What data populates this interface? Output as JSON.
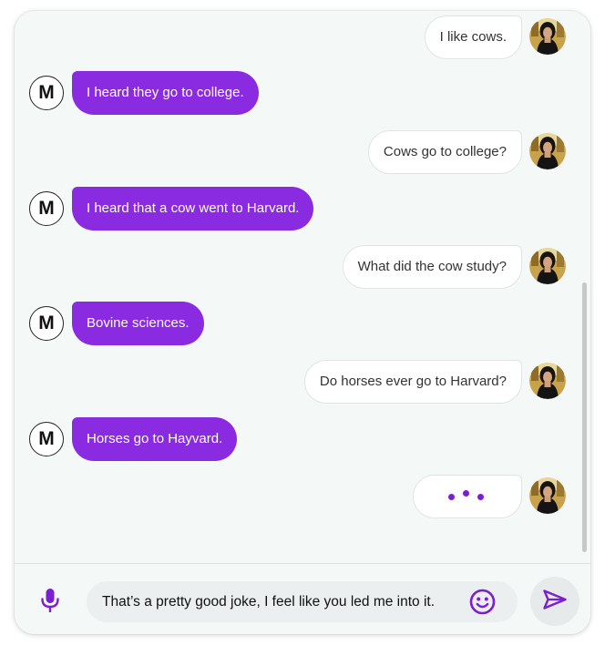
{
  "colors": {
    "accent": "#8a2be2",
    "page_background": "#f4f8f6",
    "user_bubble": "#ffffff",
    "icon_accent": "#7b1fcf"
  },
  "bot": {
    "avatar_letter": "M"
  },
  "user": {
    "avatar_icon": "user-photo-avatar"
  },
  "messages": [
    {
      "sender": "user",
      "text": "I like cows."
    },
    {
      "sender": "bot",
      "text": "I heard they go to college."
    },
    {
      "sender": "user",
      "text": "Cows go to college?"
    },
    {
      "sender": "bot",
      "text": "I heard that a cow went to Harvard."
    },
    {
      "sender": "user",
      "text": "What did the cow study?"
    },
    {
      "sender": "bot",
      "text": "Bovine sciences."
    },
    {
      "sender": "user",
      "text": "Do horses ever go to Harvard?"
    },
    {
      "sender": "bot",
      "text": "Horses go to Hayvard."
    },
    {
      "sender": "user",
      "typing": true
    }
  ],
  "composer": {
    "input_value": "That’s a pretty good joke, I feel like you led me into it.",
    "mic_icon": "microphone-icon",
    "emoji_icon": "emoji-icon",
    "send_icon": "send-icon"
  }
}
